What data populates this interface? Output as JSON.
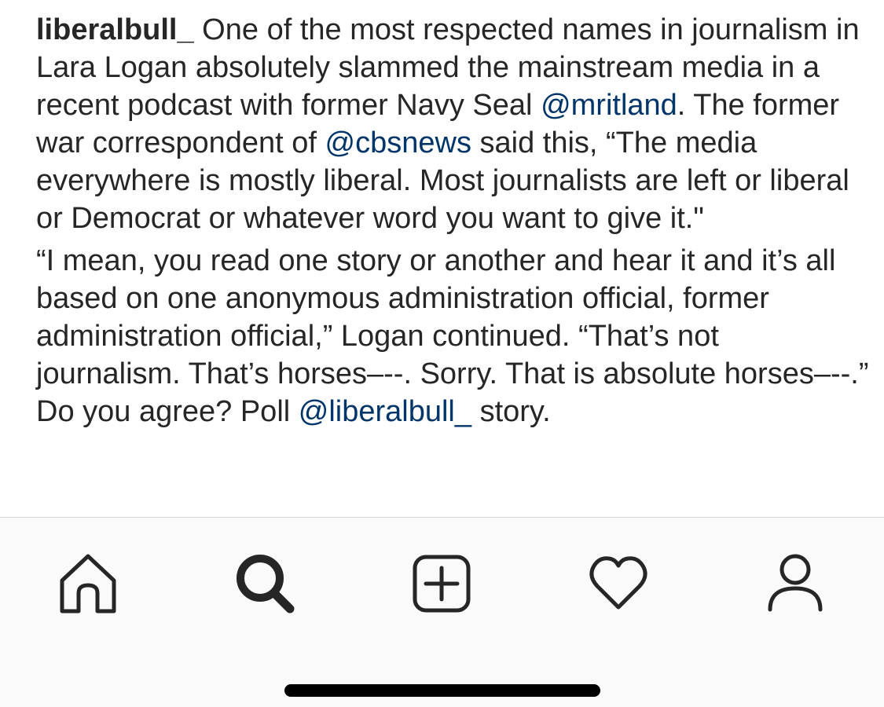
{
  "post": {
    "username": "liberalbull_",
    "paragraph1": {
      "text_a": " One of the most respected names in journalism in Lara Logan absolutely slammed the mainstream media in a recent podcast with former Navy Seal ",
      "mention_1": "@mritland",
      "text_b": ". The former war correspondent of ",
      "mention_2": "@cbsnews",
      "text_c": " said this, “The media everywhere is mostly liberal. Most journalists are left or liberal or Democrat or whatever word you want to give it.\""
    },
    "paragraph2": {
      "text_a": "“I mean, you read one story or another and hear it and it’s all based on one anonymous administration official, former administration official,” Logan continued. “That’s not journalism. That’s horses–--. Sorry. That is absolute horses–--.” Do you agree? Poll ",
      "mention_3": "@liberalbull_",
      "text_b": " story."
    }
  },
  "tab_bar": {
    "items": [
      {
        "icon": "home-icon"
      },
      {
        "icon": "search-icon"
      },
      {
        "icon": "add-post-icon"
      },
      {
        "icon": "heart-icon"
      },
      {
        "icon": "profile-icon"
      }
    ]
  },
  "colors": {
    "text": "#262626",
    "mention": "#003569",
    "tabbar_bg": "#fafafa",
    "divider": "#d6d6d6"
  }
}
